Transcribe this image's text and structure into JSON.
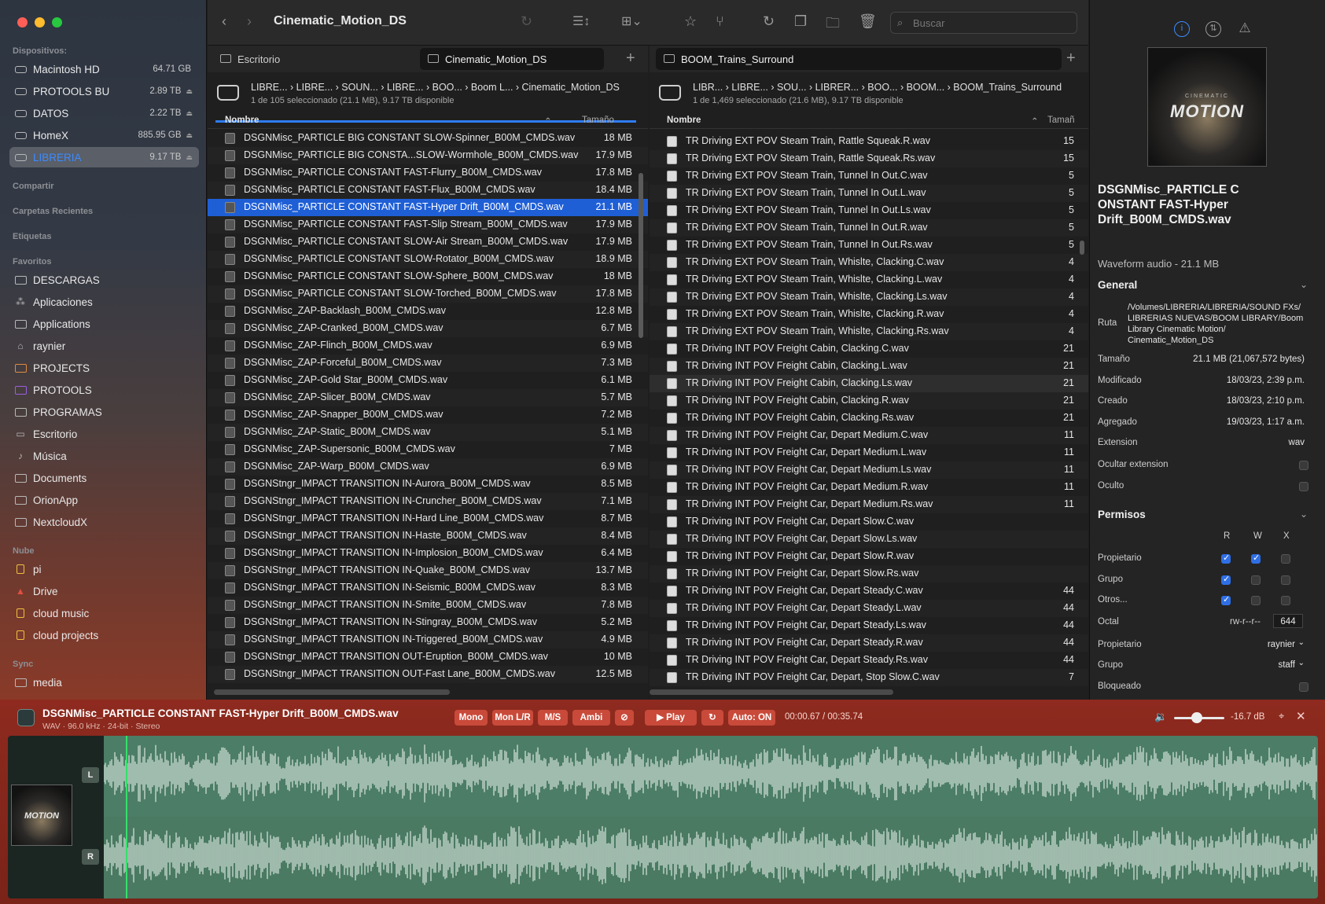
{
  "sidebar": {
    "sections": {
      "devices": "Dispositivos:",
      "share": "Compartir",
      "recent": "Carpetas Recientes",
      "tags": "Etiquetas",
      "favorites": "Favoritos",
      "cloud": "Nube",
      "sync": "Sync"
    },
    "devices": [
      {
        "label": "Macintosh HD",
        "cap": "64.71 GB",
        "icon": "drive-icon"
      },
      {
        "label": "PROTOOLS BU",
        "cap": "2.89 TB",
        "icon": "drive-icon"
      },
      {
        "label": "DATOS",
        "cap": "2.22 TB",
        "icon": "drive-icon"
      },
      {
        "label": "HomeX",
        "cap": "885.95 GB",
        "icon": "drive-icon"
      },
      {
        "label": "LIBRERIA",
        "cap": "9.17 TB",
        "icon": "drive-icon"
      }
    ],
    "favorites": [
      {
        "label": "DESCARGAS",
        "icon": "folder-icon"
      },
      {
        "label": "Aplicaciones",
        "icon": "apps-icon"
      },
      {
        "label": "Applications",
        "icon": "folder-icon"
      },
      {
        "label": "raynier",
        "icon": "home-icon"
      },
      {
        "label": "PROJECTS",
        "icon": "folder-icon"
      },
      {
        "label": "PROTOOLS",
        "icon": "folder-icon"
      },
      {
        "label": "PROGRAMAS",
        "icon": "folder-icon"
      },
      {
        "label": "Escritorio",
        "icon": "desktop-icon"
      },
      {
        "label": "Música",
        "icon": "music-icon"
      },
      {
        "label": "Documents",
        "icon": "folder-icon"
      },
      {
        "label": "OrionApp",
        "icon": "folder-icon"
      },
      {
        "label": "NextcloudX",
        "icon": "folder-icon"
      }
    ],
    "cloud": [
      {
        "label": "pi",
        "icon": "lock-icon"
      },
      {
        "label": "Drive",
        "icon": "drive-cloud-icon"
      },
      {
        "label": "cloud music",
        "icon": "lock-icon"
      },
      {
        "label": "cloud projects",
        "icon": "lock-icon"
      }
    ],
    "sync": [
      {
        "label": "media",
        "icon": "folder-icon"
      }
    ]
  },
  "toolbar": {
    "title": "Cinematic_Motion_DS",
    "search_placeholder": "Buscar"
  },
  "left_pane": {
    "tab_inactive": "Escritorio",
    "tab_active": "Cinematic_Motion_DS",
    "breadcrumb": "LIBRE...  ›  LIBRE...  ›  SOUN...  ›  LIBRE...  ›  BOO...  ›  Boom L...  ›  Cinematic_Motion_DS",
    "status": "1 de 105 seleccionado (21.1 MB), 9.17 TB disponible",
    "col_name": "Nombre",
    "col_size": "Tamaño",
    "progress": 1.0,
    "files": [
      {
        "name": "DSGNMisc_PARTICLE BIG CONSTANT SLOW-Spinner_B00M_CMDS.wav",
        "size": "18 MB"
      },
      {
        "name": "DSGNMisc_PARTICLE BIG CONSTA...SLOW-Wormhole_B00M_CMDS.wav",
        "size": "17.9 MB"
      },
      {
        "name": "DSGNMisc_PARTICLE CONSTANT FAST-Flurry_B00M_CMDS.wav",
        "size": "17.8 MB"
      },
      {
        "name": "DSGNMisc_PARTICLE CONSTANT FAST-Flux_B00M_CMDS.wav",
        "size": "18.4 MB"
      },
      {
        "name": "DSGNMisc_PARTICLE CONSTANT FAST-Hyper Drift_B00M_CMDS.wav",
        "size": "21.1 MB"
      },
      {
        "name": "DSGNMisc_PARTICLE CONSTANT FAST-Slip Stream_B00M_CMDS.wav",
        "size": "17.9 MB"
      },
      {
        "name": "DSGNMisc_PARTICLE CONSTANT SLOW-Air Stream_B00M_CMDS.wav",
        "size": "17.9 MB"
      },
      {
        "name": "DSGNMisc_PARTICLE CONSTANT SLOW-Rotator_B00M_CMDS.wav",
        "size": "18.9 MB"
      },
      {
        "name": "DSGNMisc_PARTICLE CONSTANT SLOW-Sphere_B00M_CMDS.wav",
        "size": "18 MB"
      },
      {
        "name": "DSGNMisc_PARTICLE CONSTANT SLOW-Torched_B00M_CMDS.wav",
        "size": "17.8 MB"
      },
      {
        "name": "DSGNMisc_ZAP-Backlash_B00M_CMDS.wav",
        "size": "12.8 MB"
      },
      {
        "name": "DSGNMisc_ZAP-Cranked_B00M_CMDS.wav",
        "size": "6.7 MB"
      },
      {
        "name": "DSGNMisc_ZAP-Flinch_B00M_CMDS.wav",
        "size": "6.9 MB"
      },
      {
        "name": "DSGNMisc_ZAP-Forceful_B00M_CMDS.wav",
        "size": "7.3 MB"
      },
      {
        "name": "DSGNMisc_ZAP-Gold Star_B00M_CMDS.wav",
        "size": "6.1 MB"
      },
      {
        "name": "DSGNMisc_ZAP-Slicer_B00M_CMDS.wav",
        "size": "5.7 MB"
      },
      {
        "name": "DSGNMisc_ZAP-Snapper_B00M_CMDS.wav",
        "size": "7.2 MB"
      },
      {
        "name": "DSGNMisc_ZAP-Static_B00M_CMDS.wav",
        "size": "5.1 MB"
      },
      {
        "name": "DSGNMisc_ZAP-Supersonic_B00M_CMDS.wav",
        "size": "7 MB"
      },
      {
        "name": "DSGNMisc_ZAP-Warp_B00M_CMDS.wav",
        "size": "6.9 MB"
      },
      {
        "name": "DSGNStngr_IMPACT TRANSITION IN-Aurora_B00M_CMDS.wav",
        "size": "8.5 MB"
      },
      {
        "name": "DSGNStngr_IMPACT TRANSITION IN-Cruncher_B00M_CMDS.wav",
        "size": "7.1 MB"
      },
      {
        "name": "DSGNStngr_IMPACT TRANSITION IN-Hard Line_B00M_CMDS.wav",
        "size": "8.7 MB"
      },
      {
        "name": "DSGNStngr_IMPACT TRANSITION IN-Haste_B00M_CMDS.wav",
        "size": "8.4 MB"
      },
      {
        "name": "DSGNStngr_IMPACT TRANSITION IN-Implosion_B00M_CMDS.wav",
        "size": "6.4 MB"
      },
      {
        "name": "DSGNStngr_IMPACT TRANSITION IN-Quake_B00M_CMDS.wav",
        "size": "13.7 MB"
      },
      {
        "name": "DSGNStngr_IMPACT TRANSITION IN-Seismic_B00M_CMDS.wav",
        "size": "8.3 MB"
      },
      {
        "name": "DSGNStngr_IMPACT TRANSITION IN-Smite_B00M_CMDS.wav",
        "size": "7.8 MB"
      },
      {
        "name": "DSGNStngr_IMPACT TRANSITION IN-Stingray_B00M_CMDS.wav",
        "size": "5.2 MB"
      },
      {
        "name": "DSGNStngr_IMPACT TRANSITION IN-Triggered_B00M_CMDS.wav",
        "size": "4.9 MB"
      },
      {
        "name": "DSGNStngr_IMPACT TRANSITION OUT-Eruption_B00M_CMDS.wav",
        "size": "10 MB"
      },
      {
        "name": "DSGNStngr_IMPACT TRANSITION OUT-Fast Lane_B00M_CMDS.wav",
        "size": "12.5 MB"
      }
    ]
  },
  "right_pane": {
    "tab_active": "BOOM_Trains_Surround",
    "breadcrumb": "LIBR...  ›  LIBRE...  ›  SOU...  ›  LIBRER...  ›  BOO...  ›  BOOM...  ›  BOOM_Trains_Surround",
    "status": "1 de 1,469 seleccionado (21.6 MB), 9.17 TB disponible",
    "col_name": "Nombre",
    "col_size": "Tamañ",
    "files": [
      {
        "name": "TR Driving EXT POV Steam Train, Rattle Squeak.R.wav",
        "size": "15"
      },
      {
        "name": "TR Driving EXT POV Steam Train, Rattle Squeak.Rs.wav",
        "size": "15"
      },
      {
        "name": "TR Driving EXT POV Steam Train, Tunnel In Out.C.wav",
        "size": "5"
      },
      {
        "name": "TR Driving EXT POV Steam Train, Tunnel In Out.L.wav",
        "size": "5"
      },
      {
        "name": "TR Driving EXT POV Steam Train, Tunnel In Out.Ls.wav",
        "size": "5"
      },
      {
        "name": "TR Driving EXT POV Steam Train, Tunnel In Out.R.wav",
        "size": "5"
      },
      {
        "name": "TR Driving EXT POV Steam Train, Tunnel In Out.Rs.wav",
        "size": "5"
      },
      {
        "name": "TR Driving EXT POV Steam Train, Whislte, Clacking.C.wav",
        "size": "4"
      },
      {
        "name": "TR Driving EXT POV Steam Train, Whislte, Clacking.L.wav",
        "size": "4"
      },
      {
        "name": "TR Driving EXT POV Steam Train, Whislte, Clacking.Ls.wav",
        "size": "4"
      },
      {
        "name": "TR Driving EXT POV Steam Train, Whislte, Clacking.R.wav",
        "size": "4"
      },
      {
        "name": "TR Driving EXT POV Steam Train, Whislte, Clacking.Rs.wav",
        "size": "4"
      },
      {
        "name": "TR Driving INT POV Freight Cabin, Clacking.C.wav",
        "size": "21"
      },
      {
        "name": "TR Driving INT POV Freight Cabin, Clacking.L.wav",
        "size": "21"
      },
      {
        "name": "TR Driving INT POV Freight Cabin, Clacking.Ls.wav",
        "size": "21"
      },
      {
        "name": "TR Driving INT POV Freight Cabin, Clacking.R.wav",
        "size": "21"
      },
      {
        "name": "TR Driving INT POV Freight Cabin, Clacking.Rs.wav",
        "size": "21"
      },
      {
        "name": "TR Driving INT POV Freight Car, Depart Medium.C.wav",
        "size": "11"
      },
      {
        "name": "TR Driving INT POV Freight Car, Depart Medium.L.wav",
        "size": "11"
      },
      {
        "name": "TR Driving INT POV Freight Car, Depart Medium.Ls.wav",
        "size": "11"
      },
      {
        "name": "TR Driving INT POV Freight Car, Depart Medium.R.wav",
        "size": "11"
      },
      {
        "name": "TR Driving INT POV Freight Car, Depart Medium.Rs.wav",
        "size": "11"
      },
      {
        "name": "TR Driving INT POV Freight Car, Depart Slow.C.wav",
        "size": ""
      },
      {
        "name": "TR Driving INT POV Freight Car, Depart Slow.Ls.wav",
        "size": ""
      },
      {
        "name": "TR Driving INT POV Freight Car, Depart Slow.R.wav",
        "size": ""
      },
      {
        "name": "TR Driving INT POV Freight Car, Depart Slow.Rs.wav",
        "size": ""
      },
      {
        "name": "TR Driving INT POV Freight Car, Depart Steady.C.wav",
        "size": "44"
      },
      {
        "name": "TR Driving INT POV Freight Car, Depart Steady.L.wav",
        "size": "44"
      },
      {
        "name": "TR Driving INT POV Freight Car, Depart Steady.Ls.wav",
        "size": "44"
      },
      {
        "name": "TR Driving INT POV Freight Car, Depart Steady.R.wav",
        "size": "44"
      },
      {
        "name": "TR Driving INT POV Freight Car, Depart Steady.Rs.wav",
        "size": "44"
      },
      {
        "name": "TR Driving INT POV Freight Car, Depart, Stop Slow.C.wav",
        "size": "7"
      }
    ]
  },
  "inspector": {
    "art_title": "MOTION",
    "art_sub": "CINEMATIC",
    "file_name": "DSGNMisc_PARTICLE CONSTANT FAST-Hyper Drift_B00M_CMDS.wav",
    "kind": "Waveform audio - 21.1 MB",
    "general_label": "General",
    "ruta_label": "Ruta",
    "ruta_value": "/Volumes/LIBRERIA/LIBRERIA/SOUND FXs/ LIBRERIAS NUEVAS/BOOM LIBRARY/Boom Library Cinematic Motion/ Cinematic_Motion_DS",
    "fields": [
      {
        "label": "Tamaño",
        "value": "21.1 MB (21,067,572 bytes)"
      },
      {
        "label": "Modificado",
        "value": "18/03/23, 2:39 p.m."
      },
      {
        "label": "Creado",
        "value": "18/03/23, 2:10 p.m."
      },
      {
        "label": "Agregado",
        "value": "19/03/23, 1:17 a.m."
      },
      {
        "label": "Extension",
        "value": "wav"
      }
    ],
    "hide_ext_label": "Ocultar extension",
    "hidden_label": "Oculto",
    "perms_label": "Permisos",
    "perm_cols": [
      "R",
      "W",
      "X"
    ],
    "perm_rows": [
      {
        "label": "Propietario",
        "r": true,
        "w": true,
        "x": false
      },
      {
        "label": "Grupo",
        "r": true,
        "w": false,
        "x": false
      },
      {
        "label": "Otros...",
        "r": true,
        "w": false,
        "x": false
      }
    ],
    "octal_label": "Octal",
    "octal_mode": "rw-r--r--",
    "octal_value": "644",
    "owner_label": "Propietario",
    "owner_value": "raynier",
    "group_label": "Grupo",
    "group_value": "staff",
    "locked_label": "Bloqueado"
  },
  "player": {
    "title": "DSGNMisc_PARTICLE CONSTANT FAST-Hyper Drift_B00M_CMDS.wav",
    "meta": "WAV · 96.0 kHz · 24-bit · Stereo",
    "buttons": [
      "Mono",
      "Mon L/R",
      "M/S",
      "Ambi",
      "⊘"
    ],
    "play": "▶ Play",
    "auto": "Auto: ON",
    "time": "00:00.67 / 00:35.74",
    "volume_db": "-16.7 dB",
    "volume_level": 0.45,
    "channel_left": "L",
    "channel_right": "R",
    "thumb_title": "MOTION"
  }
}
